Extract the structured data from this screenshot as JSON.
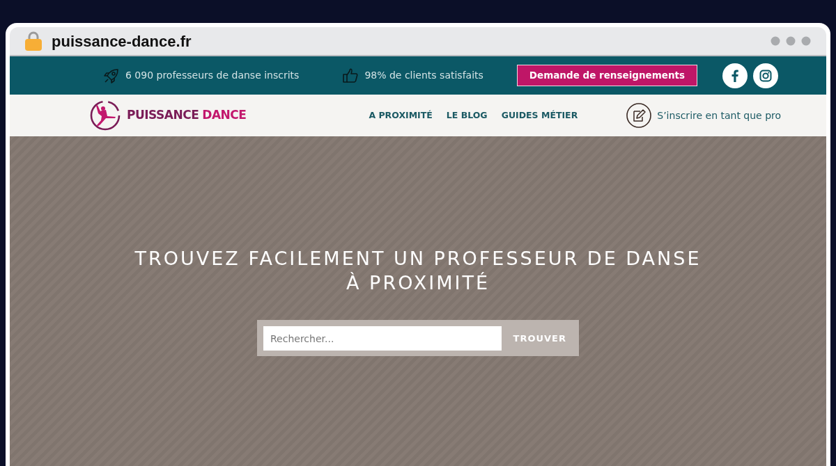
{
  "browser": {
    "address": "puissance-dance.fr"
  },
  "top_bar": {
    "stats": [
      {
        "kind": "rocket",
        "text": "6 090 professeurs de danse inscrits"
      },
      {
        "kind": "thumbs-up",
        "text": "98% de clients satisfaits"
      }
    ],
    "cta_button": "Demande de renseignements",
    "social": [
      {
        "kind": "facebook"
      },
      {
        "kind": "instagram"
      }
    ]
  },
  "nav": {
    "logo": [
      "PUISSANCE",
      "DANCE"
    ],
    "links": [
      "A PROXIMITÉ",
      "LE BLOG",
      "GUIDES MÉTIER"
    ],
    "signup": "S’inscrire en tant que pro"
  },
  "hero": {
    "title": "TROUVEZ FACILEMENT UN PROFESSEUR DE DANSE À PROXIMITÉ",
    "search": {
      "placeholder": "Rechercher...",
      "button": "TROUVER"
    }
  }
}
